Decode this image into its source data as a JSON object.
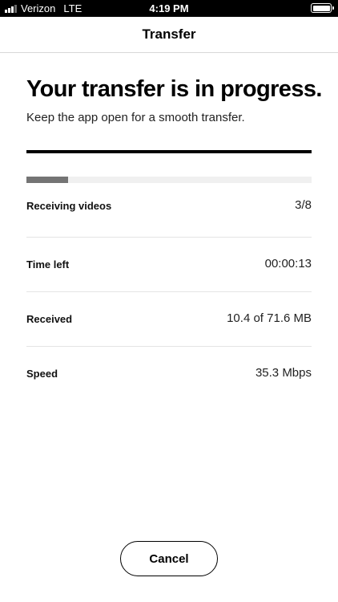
{
  "status_bar": {
    "carrier": "Verizon",
    "network": "LTE",
    "time": "4:19 PM"
  },
  "nav": {
    "title": "Transfer"
  },
  "main": {
    "headline": "Your transfer is in progress.",
    "subtext": "Keep the app open for a smooth transfer.",
    "progress_fraction": 0.145,
    "rows": [
      {
        "label": "Receiving videos",
        "value": "3/8"
      },
      {
        "label": "Time left",
        "value": "00:00:13"
      },
      {
        "label": "Received",
        "value": "10.4 of 71.6 MB"
      },
      {
        "label": "Speed",
        "value": "35.3 Mbps"
      }
    ]
  },
  "footer": {
    "cancel_label": "Cancel"
  },
  "colors": {
    "accent": "#000000",
    "progress_fill": "#747474",
    "progress_track": "#f0f0f0"
  }
}
